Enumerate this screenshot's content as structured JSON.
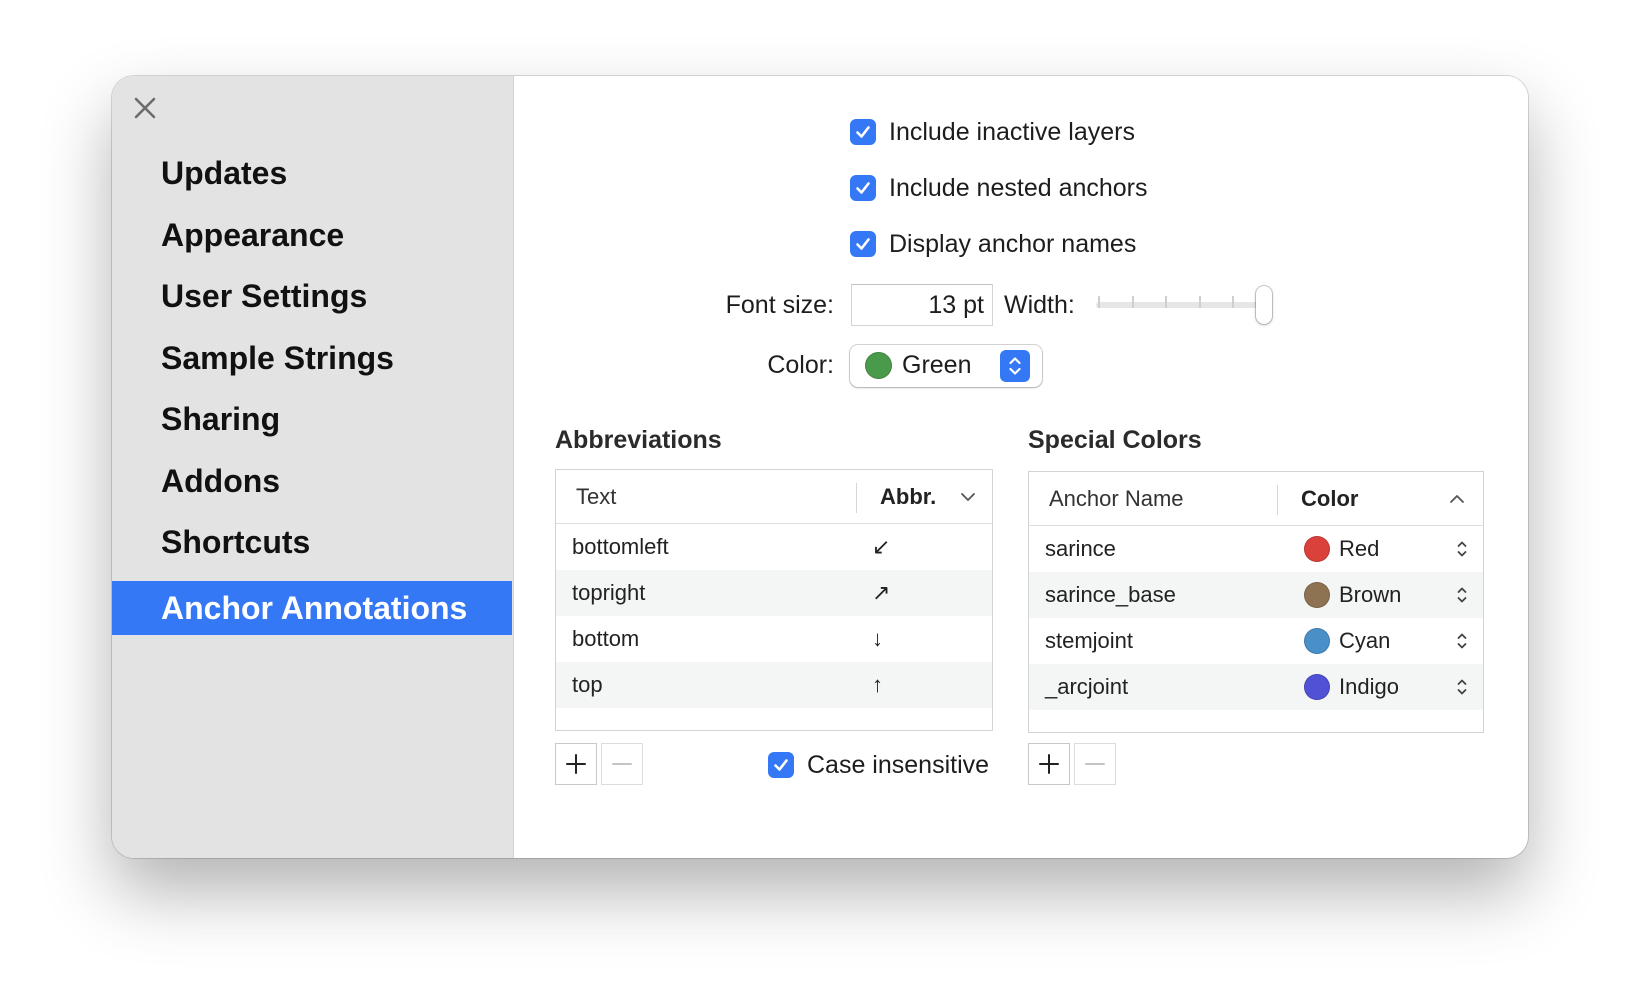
{
  "sidebar": {
    "items": [
      {
        "label": "Updates",
        "selected": false
      },
      {
        "label": "Appearance",
        "selected": false
      },
      {
        "label": "User Settings",
        "selected": false
      },
      {
        "label": "Sample Strings",
        "selected": false
      },
      {
        "label": "Sharing",
        "selected": false
      },
      {
        "label": "Addons",
        "selected": false
      },
      {
        "label": "Shortcuts",
        "selected": false
      },
      {
        "label": "Anchor Annotations",
        "selected": true
      }
    ]
  },
  "options": {
    "include_inactive_layers": {
      "label": "Include inactive layers",
      "checked": true
    },
    "include_nested_anchors": {
      "label": "Include nested anchors",
      "checked": true
    },
    "display_anchor_names": {
      "label": "Display anchor names",
      "checked": true
    }
  },
  "font_size": {
    "label": "Font size:",
    "value": "13 pt"
  },
  "width": {
    "label": "Width:",
    "slider_fraction": 1.0
  },
  "color": {
    "label": "Color:",
    "value": "Green",
    "swatch": "#4a9a4c"
  },
  "abbreviations": {
    "title": "Abbreviations",
    "columns": [
      "Text",
      "Abbr."
    ],
    "rows": [
      {
        "text": "bottomleft",
        "abbr": "↙"
      },
      {
        "text": "topright",
        "abbr": "↗"
      },
      {
        "text": "bottom",
        "abbr": "↓"
      },
      {
        "text": "top",
        "abbr": "↑"
      }
    ],
    "case_insensitive": {
      "label": "Case insensitive",
      "checked": true
    }
  },
  "special_colors": {
    "title": "Special Colors",
    "columns": [
      "Anchor Name",
      "Color"
    ],
    "rows": [
      {
        "name": "sarince",
        "color": "Red",
        "swatch": "#d9413a"
      },
      {
        "name": "sarince_base",
        "color": "Brown",
        "swatch": "#8d7352"
      },
      {
        "name": "stemjoint",
        "color": "Cyan",
        "swatch": "#4a90c8"
      },
      {
        "name": "_arcjoint",
        "color": "Indigo",
        "swatch": "#5151d6"
      }
    ]
  },
  "colors": {
    "accent": "#3478f6",
    "sidebar_bg": "#e3e3e3"
  }
}
